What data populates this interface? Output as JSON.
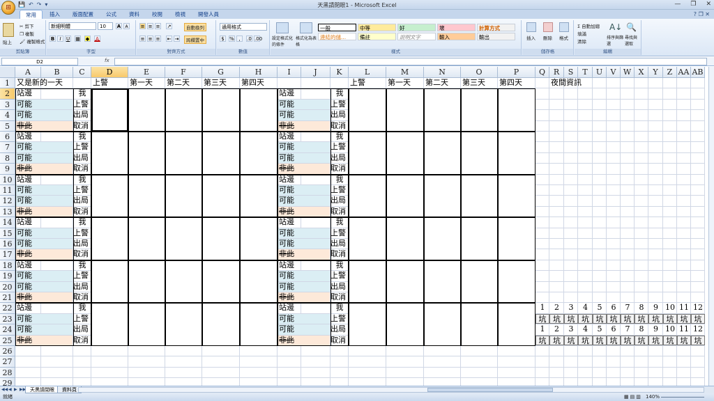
{
  "window": {
    "title": "天黑請閉眼1 - Microsoft Excel",
    "qat": [
      "💾",
      "↶",
      "↷",
      "▾"
    ],
    "controls": [
      "—",
      "❐",
      "✕"
    ],
    "help": "? ❐ ✕"
  },
  "ribbon": {
    "tabs": [
      "常用",
      "插入",
      "版面配置",
      "公式",
      "資料",
      "校閱",
      "檢視",
      "開發人員"
    ],
    "active_tab": "常用",
    "clipboard": {
      "paste": "貼上",
      "cut": "剪下",
      "copy": "複製",
      "format_painter": "複製格式",
      "label": "剪貼簿"
    },
    "font": {
      "name": "新細明體",
      "size": "10",
      "grow": "A",
      "shrink": "A",
      "bold": "B",
      "italic": "I",
      "underline": "U",
      "font_color": "A",
      "label": "字型"
    },
    "alignment": {
      "wrap": "自動換列",
      "merge": "跨欄置中",
      "label": "對齊方式"
    },
    "number": {
      "format": "通用格式",
      "currency": "$",
      "percent": "%",
      "comma": ",",
      "label": "數值"
    },
    "styles": {
      "conditional": "設定格式化的條件",
      "as_table": "格式化為表格",
      "cells": [
        {
          "text": "一般",
          "color": "#ffffff"
        },
        {
          "text": "中等",
          "color": "#ffeb9c"
        },
        {
          "text": "好",
          "color": "#c6efce"
        },
        {
          "text": "壞",
          "color": "#ffc7ce"
        },
        {
          "text": "計算方式",
          "color": "#f2f2f2"
        },
        {
          "text": "連結的儲...",
          "color": "#ffffff"
        },
        {
          "text": "備註",
          "color": "#ffffcc"
        },
        {
          "text": "說明文字",
          "color": "#ffffff"
        },
        {
          "text": "輸入",
          "color": "#ffcc99"
        },
        {
          "text": "輸出",
          "color": "#f2f2f2"
        }
      ],
      "label": "樣式"
    },
    "cells_group": {
      "insert": "插入",
      "delete": "刪除",
      "format": "格式",
      "label": "儲存格"
    },
    "editing": {
      "autosum": "Σ 自動加總",
      "fill": "填滿",
      "clear": "清除",
      "sort": "排序與篩選",
      "find": "尋找與選取",
      "label": "編輯"
    }
  },
  "formula_bar": {
    "name_box": "D2",
    "fx": "fx",
    "content": ""
  },
  "grid": {
    "columns": [
      "A",
      "B",
      "C",
      "D",
      "E",
      "F",
      "G",
      "H",
      "I",
      "J",
      "K",
      "L",
      "M",
      "N",
      "O",
      "P",
      "Q",
      "R",
      "S",
      "T",
      "U",
      "V",
      "W",
      "X",
      "Y",
      "Z",
      "AA",
      "AB"
    ],
    "selected_column": "D",
    "rows": [
      "1",
      "2",
      "3",
      "4",
      "5",
      "6",
      "7",
      "8",
      "9",
      "10",
      "11",
      "12",
      "13",
      "14",
      "15",
      "16",
      "17",
      "18",
      "19",
      "20",
      "21",
      "22",
      "23",
      "24",
      "25",
      "26",
      "27",
      "28",
      "29"
    ],
    "selected_row": "2",
    "row1": {
      "a": "又是新的一天",
      "d": "上警",
      "e": "第一天",
      "f": "第二天",
      "g": "第三天",
      "h": "第四天",
      "l": "上警",
      "m": "第一天",
      "n": "第二天",
      "o": "第三天",
      "p": "第四天",
      "r": "夜間資訊"
    },
    "block_left": [
      "站邊",
      "可能",
      "可能",
      "非此"
    ],
    "block_right_col": [
      "我",
      "上警",
      "出局",
      "取消"
    ],
    "pit_numbers": [
      "1",
      "2",
      "3",
      "4",
      "5",
      "6",
      "7",
      "8",
      "9",
      "10",
      "11",
      "12"
    ],
    "pit_label": "坑"
  },
  "sheet_tabs": {
    "nav": [
      "◀◀",
      "◀",
      "▶",
      "▶▶"
    ],
    "tabs": [
      "天黑請閉眼",
      "資料頁"
    ],
    "active": "天黑請閉眼"
  },
  "status": {
    "ready": "就緒",
    "zoom": "140%"
  }
}
